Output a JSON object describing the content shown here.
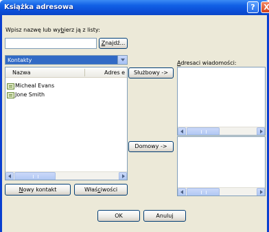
{
  "window": {
    "title": "Książka adresowa",
    "help_button": "?",
    "close_button": "X"
  },
  "search": {
    "label_before": "Wpisz nazwę lub wy",
    "label_mnemonic": "b",
    "label_after": "ierz ją z listy:",
    "value": "",
    "find_mnemonic": "Z",
    "find_rest": "najdź..."
  },
  "book_selector": {
    "selected": "Kontakty"
  },
  "contacts": {
    "columns": [
      "Nazwa",
      "Adres e"
    ],
    "items": [
      {
        "name": "Micheal Evans"
      },
      {
        "name": "Jone Smith"
      }
    ]
  },
  "recipients": {
    "label_mnemonic": "A",
    "label_rest": "dresaci wiadomości:",
    "service_button": "Służbowy ->",
    "home_button": "Domowy ->"
  },
  "actions": {
    "new_contact_mnemonic": "N",
    "new_contact_rest": "owy kontakt",
    "properties_before": "Właś",
    "properties_mnemonic": "c",
    "properties_after": "iwości",
    "ok": "OK",
    "cancel": "Anuluj"
  }
}
